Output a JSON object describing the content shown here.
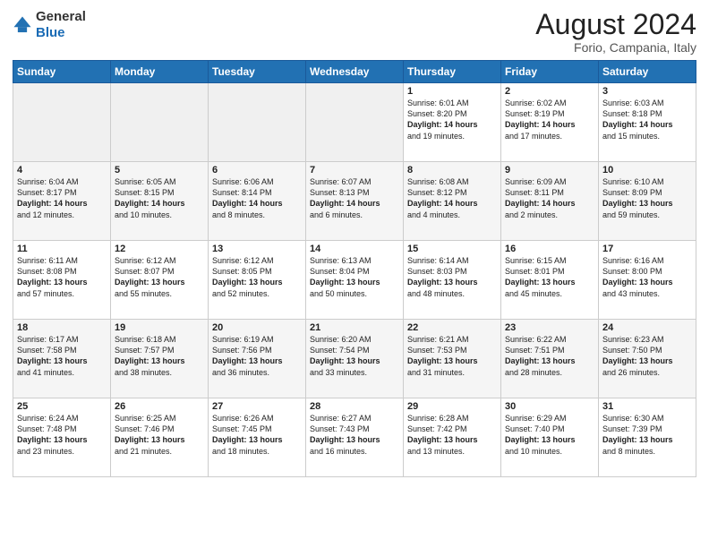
{
  "logo": {
    "general": "General",
    "blue": "Blue"
  },
  "header": {
    "month_year": "August 2024",
    "location": "Forio, Campania, Italy"
  },
  "days_of_week": [
    "Sunday",
    "Monday",
    "Tuesday",
    "Wednesday",
    "Thursday",
    "Friday",
    "Saturday"
  ],
  "weeks": [
    [
      {
        "day": "",
        "content": ""
      },
      {
        "day": "",
        "content": ""
      },
      {
        "day": "",
        "content": ""
      },
      {
        "day": "",
        "content": ""
      },
      {
        "day": "1",
        "content": "Sunrise: 6:01 AM\nSunset: 8:20 PM\nDaylight: 14 hours\nand 19 minutes."
      },
      {
        "day": "2",
        "content": "Sunrise: 6:02 AM\nSunset: 8:19 PM\nDaylight: 14 hours\nand 17 minutes."
      },
      {
        "day": "3",
        "content": "Sunrise: 6:03 AM\nSunset: 8:18 PM\nDaylight: 14 hours\nand 15 minutes."
      }
    ],
    [
      {
        "day": "4",
        "content": "Sunrise: 6:04 AM\nSunset: 8:17 PM\nDaylight: 14 hours\nand 12 minutes."
      },
      {
        "day": "5",
        "content": "Sunrise: 6:05 AM\nSunset: 8:15 PM\nDaylight: 14 hours\nand 10 minutes."
      },
      {
        "day": "6",
        "content": "Sunrise: 6:06 AM\nSunset: 8:14 PM\nDaylight: 14 hours\nand 8 minutes."
      },
      {
        "day": "7",
        "content": "Sunrise: 6:07 AM\nSunset: 8:13 PM\nDaylight: 14 hours\nand 6 minutes."
      },
      {
        "day": "8",
        "content": "Sunrise: 6:08 AM\nSunset: 8:12 PM\nDaylight: 14 hours\nand 4 minutes."
      },
      {
        "day": "9",
        "content": "Sunrise: 6:09 AM\nSunset: 8:11 PM\nDaylight: 14 hours\nand 2 minutes."
      },
      {
        "day": "10",
        "content": "Sunrise: 6:10 AM\nSunset: 8:09 PM\nDaylight: 13 hours\nand 59 minutes."
      }
    ],
    [
      {
        "day": "11",
        "content": "Sunrise: 6:11 AM\nSunset: 8:08 PM\nDaylight: 13 hours\nand 57 minutes."
      },
      {
        "day": "12",
        "content": "Sunrise: 6:12 AM\nSunset: 8:07 PM\nDaylight: 13 hours\nand 55 minutes."
      },
      {
        "day": "13",
        "content": "Sunrise: 6:12 AM\nSunset: 8:05 PM\nDaylight: 13 hours\nand 52 minutes."
      },
      {
        "day": "14",
        "content": "Sunrise: 6:13 AM\nSunset: 8:04 PM\nDaylight: 13 hours\nand 50 minutes."
      },
      {
        "day": "15",
        "content": "Sunrise: 6:14 AM\nSunset: 8:03 PM\nDaylight: 13 hours\nand 48 minutes."
      },
      {
        "day": "16",
        "content": "Sunrise: 6:15 AM\nSunset: 8:01 PM\nDaylight: 13 hours\nand 45 minutes."
      },
      {
        "day": "17",
        "content": "Sunrise: 6:16 AM\nSunset: 8:00 PM\nDaylight: 13 hours\nand 43 minutes."
      }
    ],
    [
      {
        "day": "18",
        "content": "Sunrise: 6:17 AM\nSunset: 7:58 PM\nDaylight: 13 hours\nand 41 minutes."
      },
      {
        "day": "19",
        "content": "Sunrise: 6:18 AM\nSunset: 7:57 PM\nDaylight: 13 hours\nand 38 minutes."
      },
      {
        "day": "20",
        "content": "Sunrise: 6:19 AM\nSunset: 7:56 PM\nDaylight: 13 hours\nand 36 minutes."
      },
      {
        "day": "21",
        "content": "Sunrise: 6:20 AM\nSunset: 7:54 PM\nDaylight: 13 hours\nand 33 minutes."
      },
      {
        "day": "22",
        "content": "Sunrise: 6:21 AM\nSunset: 7:53 PM\nDaylight: 13 hours\nand 31 minutes."
      },
      {
        "day": "23",
        "content": "Sunrise: 6:22 AM\nSunset: 7:51 PM\nDaylight: 13 hours\nand 28 minutes."
      },
      {
        "day": "24",
        "content": "Sunrise: 6:23 AM\nSunset: 7:50 PM\nDaylight: 13 hours\nand 26 minutes."
      }
    ],
    [
      {
        "day": "25",
        "content": "Sunrise: 6:24 AM\nSunset: 7:48 PM\nDaylight: 13 hours\nand 23 minutes."
      },
      {
        "day": "26",
        "content": "Sunrise: 6:25 AM\nSunset: 7:46 PM\nDaylight: 13 hours\nand 21 minutes."
      },
      {
        "day": "27",
        "content": "Sunrise: 6:26 AM\nSunset: 7:45 PM\nDaylight: 13 hours\nand 18 minutes."
      },
      {
        "day": "28",
        "content": "Sunrise: 6:27 AM\nSunset: 7:43 PM\nDaylight: 13 hours\nand 16 minutes."
      },
      {
        "day": "29",
        "content": "Sunrise: 6:28 AM\nSunset: 7:42 PM\nDaylight: 13 hours\nand 13 minutes."
      },
      {
        "day": "30",
        "content": "Sunrise: 6:29 AM\nSunset: 7:40 PM\nDaylight: 13 hours\nand 10 minutes."
      },
      {
        "day": "31",
        "content": "Sunrise: 6:30 AM\nSunset: 7:39 PM\nDaylight: 13 hours\nand 8 minutes."
      }
    ]
  ]
}
